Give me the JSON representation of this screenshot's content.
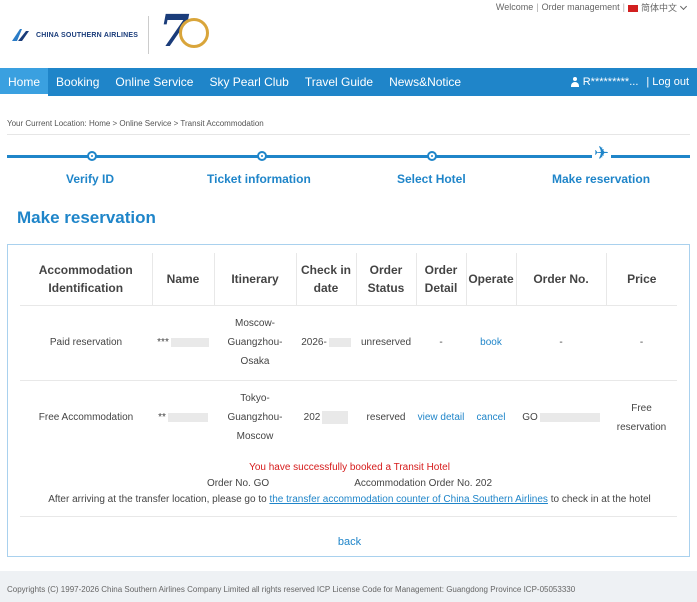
{
  "toplinks": {
    "welcome": "Welcome",
    "order_management": "Order management",
    "language": "简体中文"
  },
  "brand": {
    "name": "CHINA SOUTHERN AIRLINES",
    "anniversary_tag": "70 Years"
  },
  "nav": {
    "items": [
      "Home",
      "Booking",
      "Online Service",
      "Sky Pearl Club",
      "Travel Guide",
      "News&Notice"
    ],
    "user": "R*********...",
    "logout": "Log out"
  },
  "breadcrumb": "Your Current Location: Home > Online Service > Transit Accommodation",
  "steps": [
    "Verify ID",
    "Ticket information",
    "Select Hotel",
    "Make reservation"
  ],
  "section_title": "Make reservation",
  "table": {
    "headers": [
      "Accommodation Identification",
      "Name",
      "Itinerary",
      "Check in date",
      "Order Status",
      "Order Detail",
      "Operate",
      "Order No.",
      "Price"
    ],
    "rows": [
      {
        "identification": "Paid reservation",
        "name": "***",
        "itinerary_parts": [
          "Moscow-",
          "Guangzhou-",
          "Osaka"
        ],
        "checkin": "2026-",
        "status": "unreserved",
        "detail": "-",
        "operate": "book",
        "order_no": "-",
        "price_parts": [
          "-"
        ]
      },
      {
        "identification": "Free Accommodation",
        "name": "**",
        "itinerary_parts": [
          "Tokyo-",
          "Guangzhou-",
          "Moscow"
        ],
        "checkin": "202",
        "status": "reserved",
        "detail": "view detail",
        "operate": "cancel",
        "order_no": "GO",
        "price_parts": [
          "Free",
          "reservation"
        ]
      }
    ]
  },
  "result": {
    "success": "You have successfully booked a Transit Hotel",
    "order_no_label": "Order No. GO",
    "accommodation_order_label": "Accommodation Order No. 202",
    "notice_before": "After arriving at the transfer location, please go to",
    "notice_link": "the transfer accommodation counter of China Southern Airlines",
    "notice_after": "to check in at the hotel"
  },
  "back": "back",
  "footer": "Copyrights (C) 1997-2026 China Southern Airlines Company Limited all rights reserved ICP License Code for Management: Guangdong Province ICP-05053330",
  "colors": {
    "primary": "#1f85c9",
    "error": "#d61b1b",
    "navy": "#1a3c7a"
  }
}
